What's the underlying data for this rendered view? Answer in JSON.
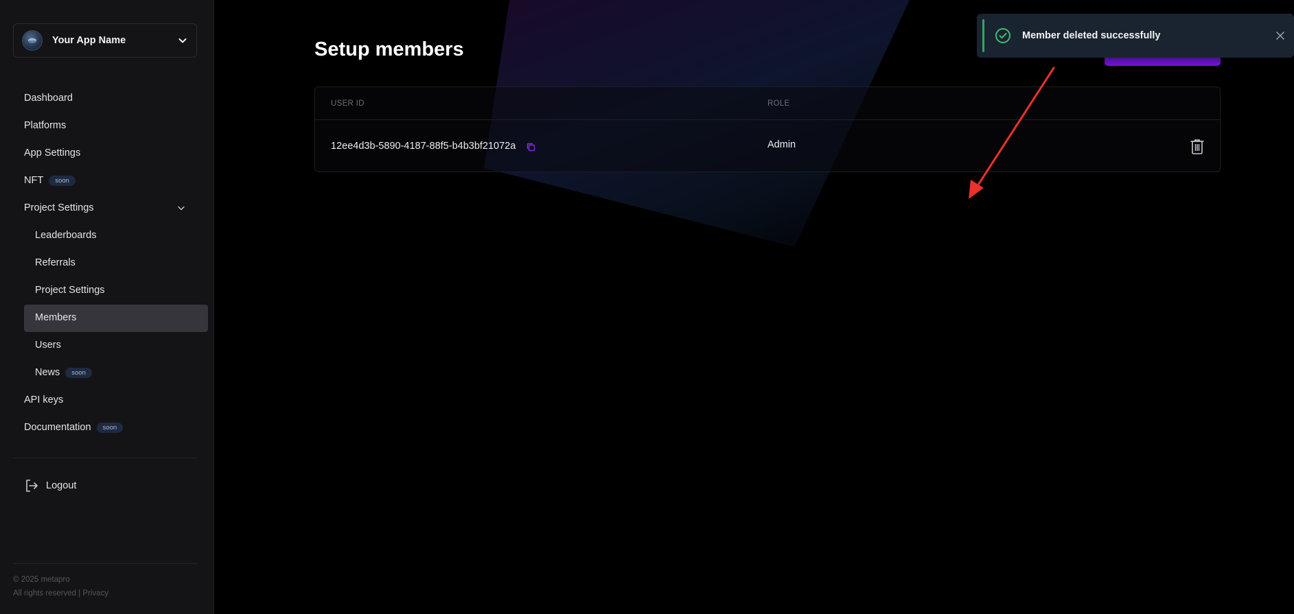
{
  "sidebar": {
    "app_name": "Your App Name",
    "nav": [
      {
        "label": "Dashboard"
      },
      {
        "label": "Platforms"
      },
      {
        "label": "App Settings"
      },
      {
        "label": "NFT",
        "badge": "soon"
      },
      {
        "label": "Project Settings"
      },
      {
        "label": "Leaderboards"
      },
      {
        "label": "Referrals"
      },
      {
        "label": "Project Settings"
      },
      {
        "label": "Members"
      },
      {
        "label": "Users"
      },
      {
        "label": "News",
        "badge": "soon"
      },
      {
        "label": "API keys"
      },
      {
        "label": "Documentation",
        "badge": "soon"
      }
    ],
    "logout_label": "Logout",
    "footer": {
      "copyright": "© 2025 metapro",
      "rights": "All rights reserved | ",
      "privacy": "Privacy"
    }
  },
  "main": {
    "title": "Setup members",
    "table": {
      "headers": [
        "USER ID",
        "ROLE"
      ],
      "rows": [
        {
          "user_id": "12ee4d3b-5890-4187-88f5-b4b3bf21072a",
          "role": "Admin"
        }
      ]
    }
  },
  "toast": {
    "message": "Member deleted successfully",
    "status_color": "#2ea95a"
  },
  "colors": {
    "accent": "#7a14e6",
    "sidebar_bg": "#141417",
    "active_item_bg": "#35353b",
    "annotation": "#e8322a"
  },
  "icons": [
    "app-logo-icon",
    "chevron-down-icon",
    "logout-icon",
    "copy-icon",
    "trash-icon",
    "check-circle-icon",
    "close-icon",
    "annotation-arrow"
  ]
}
